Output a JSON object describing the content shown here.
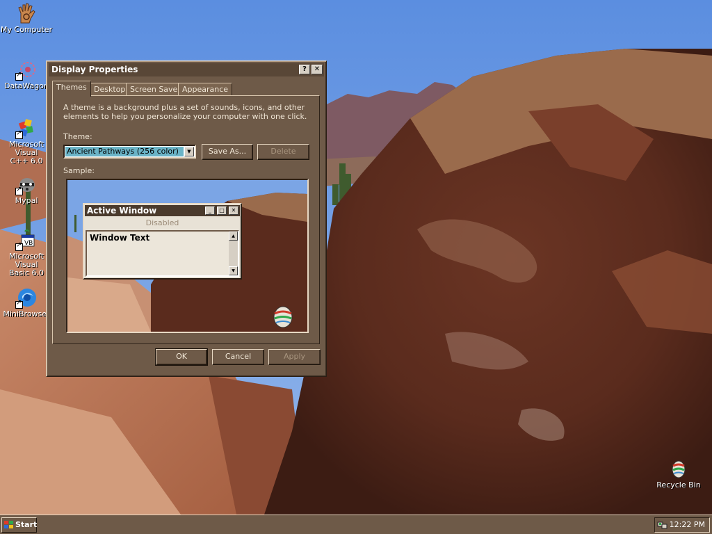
{
  "desktop": {
    "icons": [
      {
        "label": "My Computer",
        "icon": "hand-spiral-icon"
      },
      {
        "label": "DataWagon",
        "icon": "datawagon-icon"
      },
      {
        "label": "Microsoft Visual\nC++ 6.0",
        "icon": "visual-cpp-icon"
      },
      {
        "label": "Mypal",
        "icon": "raccoon-icon"
      },
      {
        "label": "Microsoft Visual\nBasic 6.0",
        "icon": "visual-basic-icon"
      },
      {
        "label": "MiniBrowser",
        "icon": "minibrowser-icon"
      },
      {
        "label": "Recycle Bin",
        "icon": "recycle-bin-icon"
      }
    ]
  },
  "dialog": {
    "title": "Display Properties",
    "help_button": "?",
    "close_button": "✕",
    "tabs": [
      {
        "label": "Themes",
        "active": true
      },
      {
        "label": "Desktop",
        "active": false
      },
      {
        "label": "Screen Saver",
        "active": false
      },
      {
        "label": "Appearance",
        "active": false
      }
    ],
    "description": "A theme is a background plus a set of sounds, icons, and other elements to help you personalize your computer with one click.",
    "theme_label": "Theme:",
    "theme_value": "Ancient Pathways (256 color)",
    "save_as_button": "Save As...",
    "delete_button": "Delete",
    "sample_label": "Sample:",
    "sample": {
      "window_title": "Active Window",
      "menu_disabled": "Disabled",
      "window_text": "Window Text"
    },
    "ok_button": "OK",
    "cancel_button": "Cancel",
    "apply_button": "Apply"
  },
  "taskbar": {
    "start_label": "Start",
    "clock": "12:22 PM"
  },
  "colors": {
    "dialog_face": "#6e5a48",
    "title_bar": "#594737",
    "selection": "#6ab4c7"
  }
}
